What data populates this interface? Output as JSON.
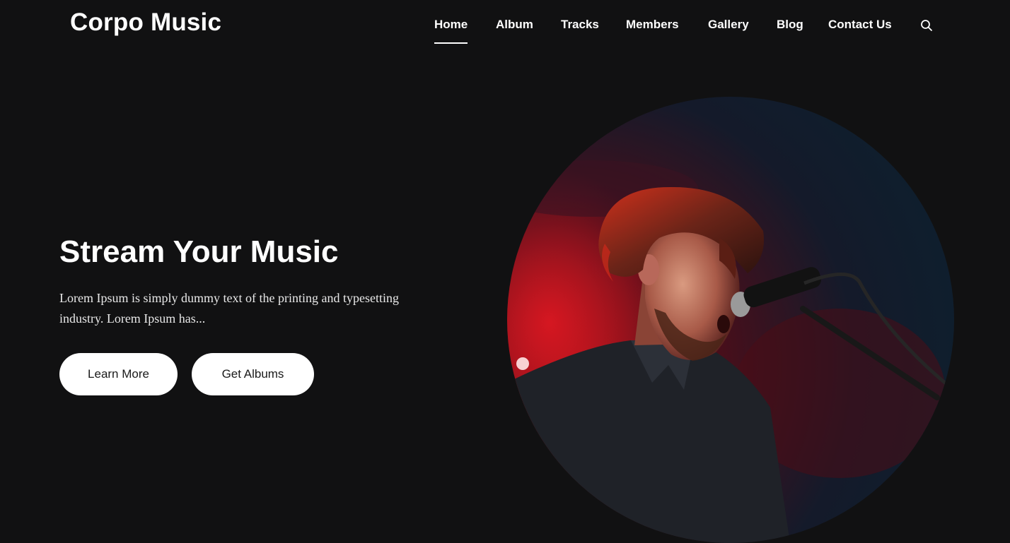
{
  "site": {
    "logo": "Corpo Music"
  },
  "nav": {
    "items": [
      {
        "label": "Home",
        "active": true
      },
      {
        "label": "Album",
        "active": false
      },
      {
        "label": "Tracks",
        "active": false
      },
      {
        "label": "Members",
        "active": false
      },
      {
        "label": "Gallery",
        "active": false
      },
      {
        "label": "Blog",
        "active": false
      },
      {
        "label": "Contact Us",
        "active": false
      }
    ],
    "search_icon": "search-icon"
  },
  "hero": {
    "title": "Stream Your Music",
    "description": "Lorem Ipsum is simply dummy text of the printing and typesetting industry. Lorem Ipsum has...",
    "buttons": {
      "learn_more": "Learn More",
      "get_albums": "Get Albums"
    },
    "image": "singer-with-microphone-photo"
  },
  "colors": {
    "background": "#111112",
    "text": "#ffffff",
    "button_bg": "#ffffff",
    "button_text": "#1a1a1a",
    "stage_red": "#c0121c"
  }
}
